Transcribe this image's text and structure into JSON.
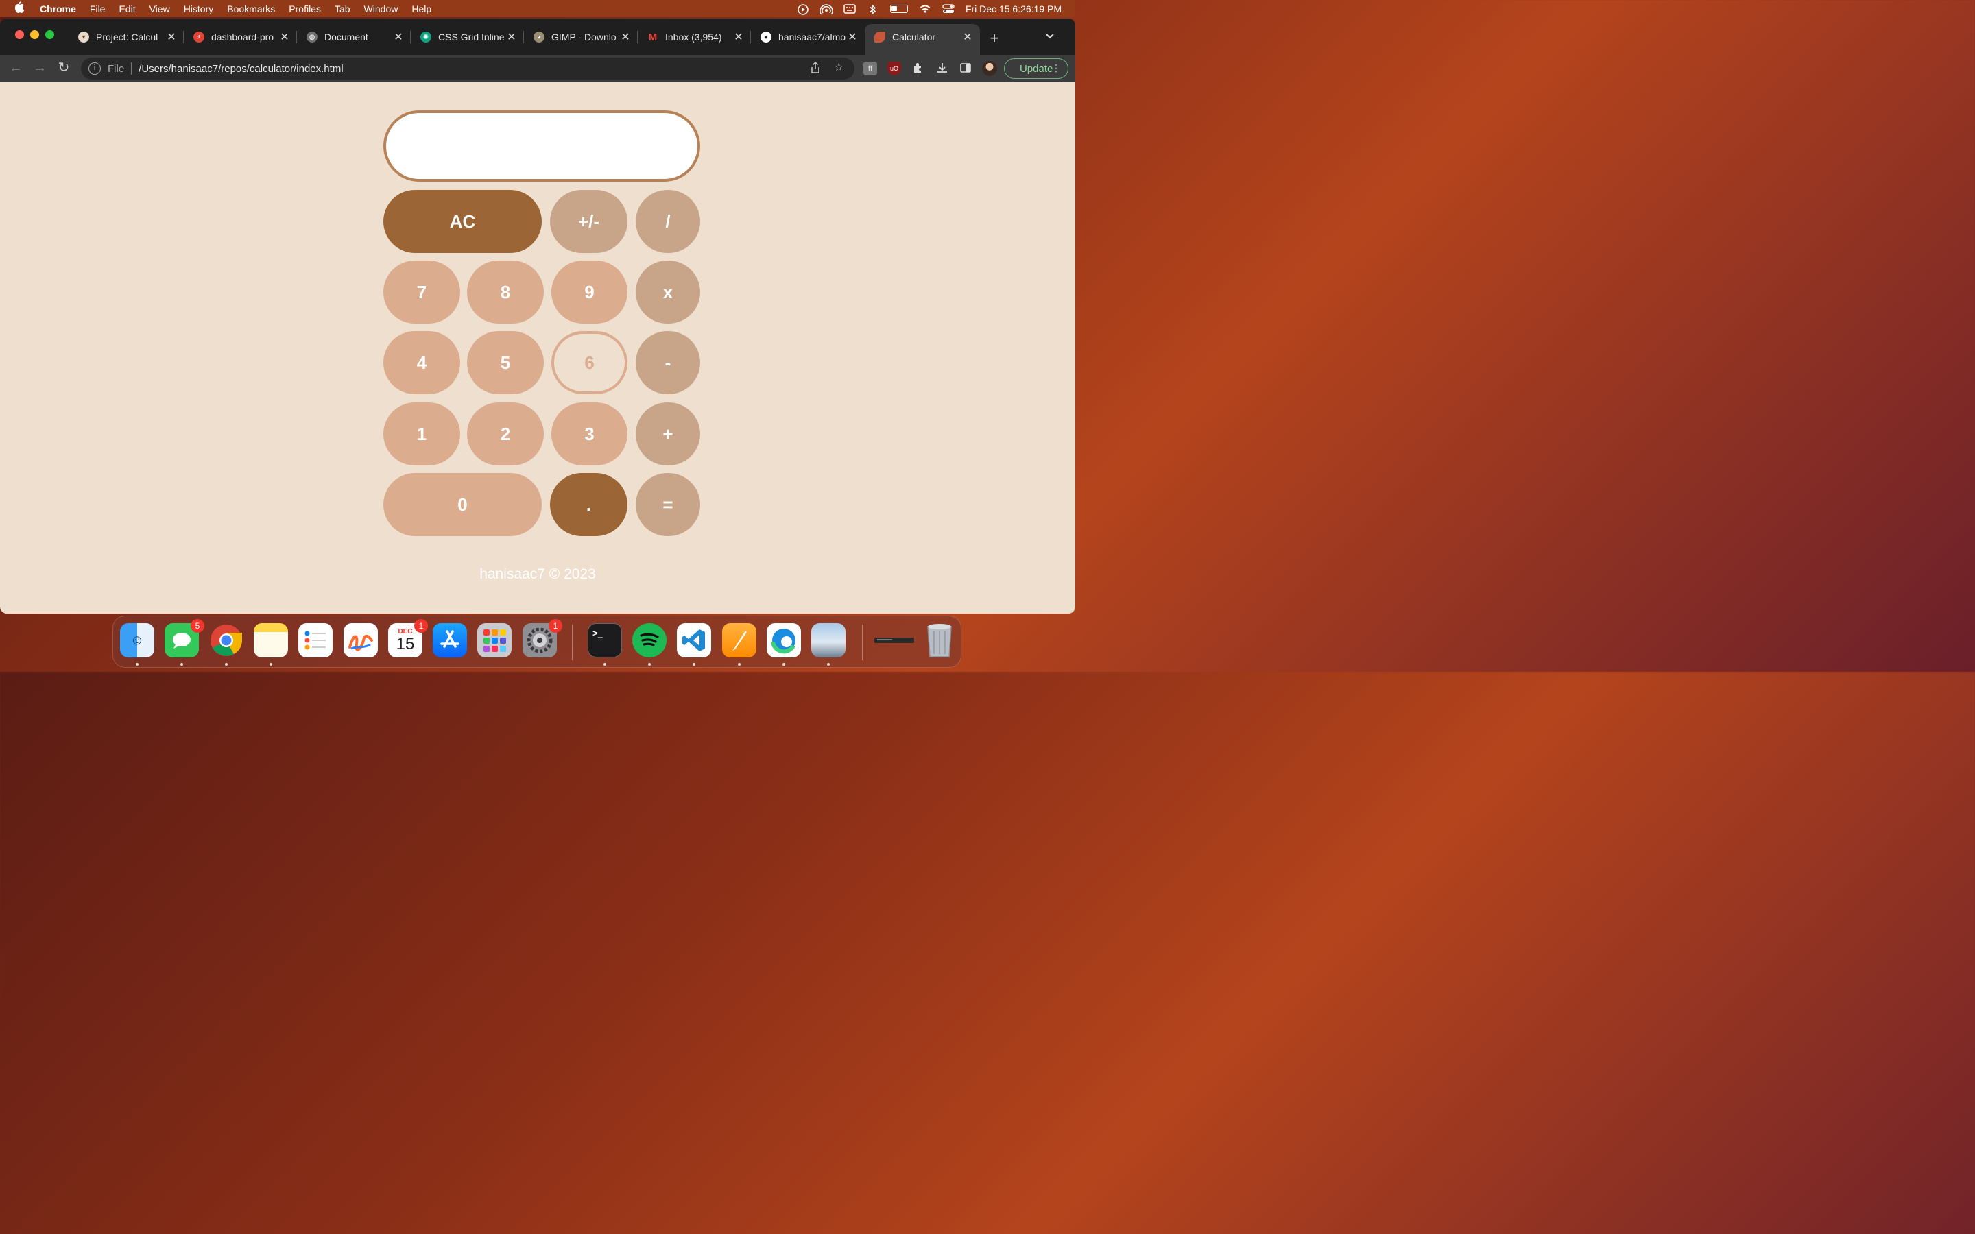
{
  "menubar": {
    "app_name": "Chrome",
    "menus": [
      "File",
      "Edit",
      "View",
      "History",
      "Bookmarks",
      "Profiles",
      "Tab",
      "Window",
      "Help"
    ],
    "status_icons": [
      "play-icon",
      "airdrop-icon",
      "keyboard-icon",
      "bluetooth-icon",
      "battery-icon",
      "wifi-icon",
      "control-center-icon"
    ],
    "clock": "Fri Dec 15  6:26:19 PM"
  },
  "tabs": [
    {
      "title": "Project: Calcul",
      "favicon": "odin-icon",
      "color": "#e0e0e0"
    },
    {
      "title": "dashboard-pro",
      "favicon": "bolt-icon",
      "color": "#e34234"
    },
    {
      "title": "Document",
      "favicon": "globe-icon",
      "color": "#9aa0a6"
    },
    {
      "title": "CSS Grid Inline",
      "favicon": "chatgpt-icon",
      "color": "#10a37f"
    },
    {
      "title": "GIMP - Downlo",
      "favicon": "gimp-icon",
      "color": "#9a8c70"
    },
    {
      "title": "Inbox (3,954)",
      "favicon": "gmail-icon",
      "color": "#ea4335"
    },
    {
      "title": "hanisaac7/almo",
      "favicon": "github-icon",
      "color": "#ffffff"
    },
    {
      "title": "Calculator",
      "favicon": "almond-icon",
      "color": "#c8583a",
      "active": true
    }
  ],
  "toolbar": {
    "scheme": "File",
    "url": "/Users/hanisaac7/repos/calculator/index.html",
    "update_label": "Update"
  },
  "calculator": {
    "display_value": "",
    "keys": {
      "ac": "AC",
      "sign": "+/-",
      "divide": "/",
      "seven": "7",
      "eight": "8",
      "nine": "9",
      "multiply": "x",
      "four": "4",
      "five": "5",
      "six": "6",
      "subtract": "-",
      "one": "1",
      "two": "2",
      "three": "3",
      "add": "+",
      "zero": "0",
      "decimal": ".",
      "equals": "="
    },
    "footer": "hanisaac7 © 2023",
    "colors": {
      "dark": "#9b6535",
      "light": "#dcac8e",
      "tan": "#c8a588",
      "background": "#efdfcf",
      "display_border": "#b78257"
    }
  },
  "dock": {
    "apps": [
      "Finder",
      "Messages",
      "Google Chrome",
      "Notes",
      "Reminders",
      "Freeform",
      "Calendar",
      "App Store",
      "Launchpad",
      "System Settings",
      "Terminal",
      "Spotify",
      "Visual Studio Code",
      "Pages",
      "Microsoft Edge",
      "Preview"
    ],
    "badges": {
      "messages": "5",
      "calendar": "1",
      "settings": "1"
    },
    "calendar_month": "DEC",
    "calendar_day": "15"
  }
}
